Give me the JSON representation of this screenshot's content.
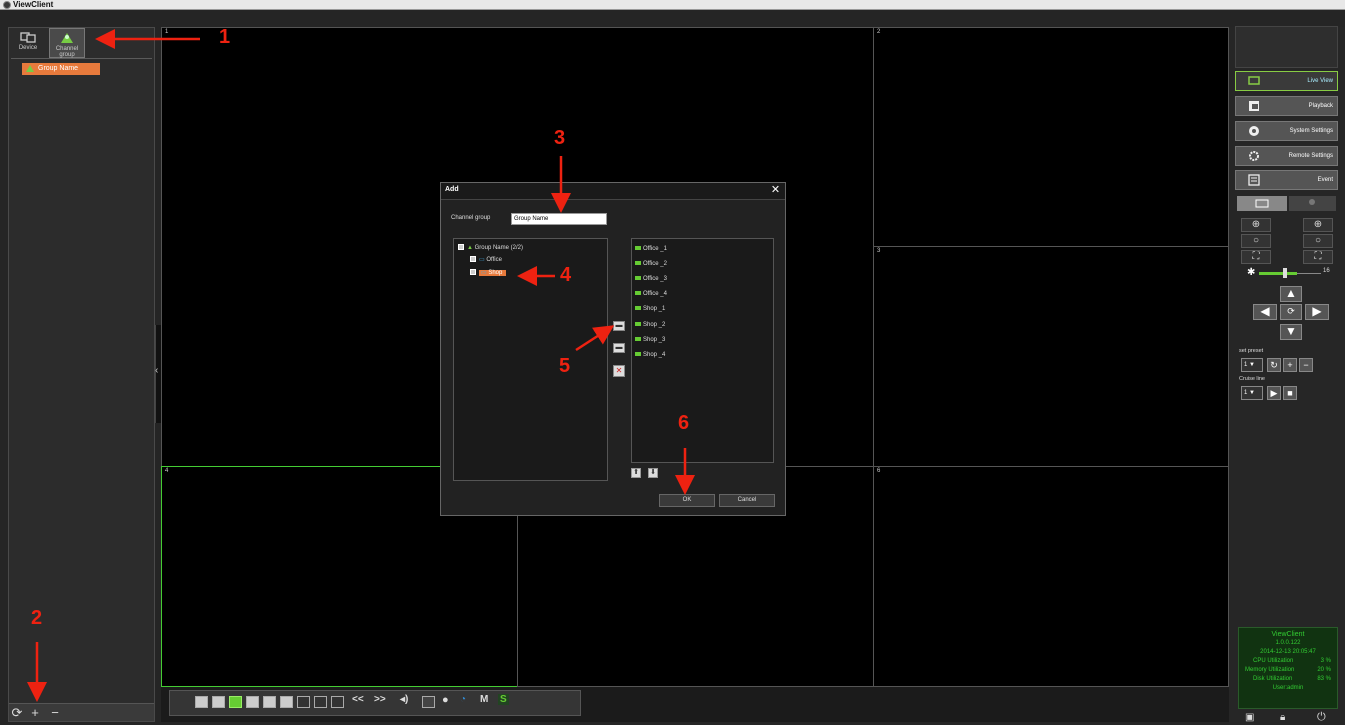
{
  "window": {
    "title": "ViewClient"
  },
  "left_panel": {
    "tabs": [
      {
        "label": "Device"
      },
      {
        "label": "Channel group"
      }
    ],
    "group_item": "Group Name",
    "bottom_buttons": [
      "⟳",
      "+",
      "−"
    ]
  },
  "grid": {
    "cells": [
      "1",
      "2",
      "3",
      "4",
      "5",
      "6"
    ]
  },
  "right_panel": {
    "nav": [
      "Live View",
      "Playback",
      "System Settings",
      "Remote Settings",
      "Event"
    ],
    "zoom_value": "16",
    "set_preset_label": "set preset",
    "cruise_line_label": "Cruise line",
    "preset_value": "1",
    "cruise_value": "1",
    "status": {
      "app": "ViewClient",
      "version": "1.0.0.122",
      "datetime": "2014-12-13 20:05:47",
      "cpu_label": "CPU Utilization",
      "cpu_value": "3 %",
      "mem_label": "Memory Utilization",
      "mem_value": "20 %",
      "disk_label": "Disk Utilization",
      "disk_value": "83 %",
      "user": "User:admin"
    }
  },
  "dialog": {
    "title": "Add",
    "close": "✕",
    "channel_group_label": "Channel group",
    "channel_group_value": "Group Name",
    "tree": {
      "root": "Group Name (2/2)",
      "children": [
        "Office",
        "Shop"
      ]
    },
    "channels": [
      "Office _1",
      "Office _2",
      "Office _3",
      "Office _4",
      "Shop _1",
      "Shop _2",
      "Shop _3",
      "Shop _4"
    ],
    "ok_label": "OK",
    "cancel_label": "Cancel"
  },
  "toolbar": {
    "prev": "<<",
    "next": ">>",
    "m_label": "M",
    "s_label": "S"
  },
  "annotations": [
    "1",
    "2",
    "3",
    "4",
    "5",
    "6"
  ],
  "colors": {
    "accent": "#e77a3c",
    "green": "#66cc33",
    "annotation": "#ee2211"
  }
}
